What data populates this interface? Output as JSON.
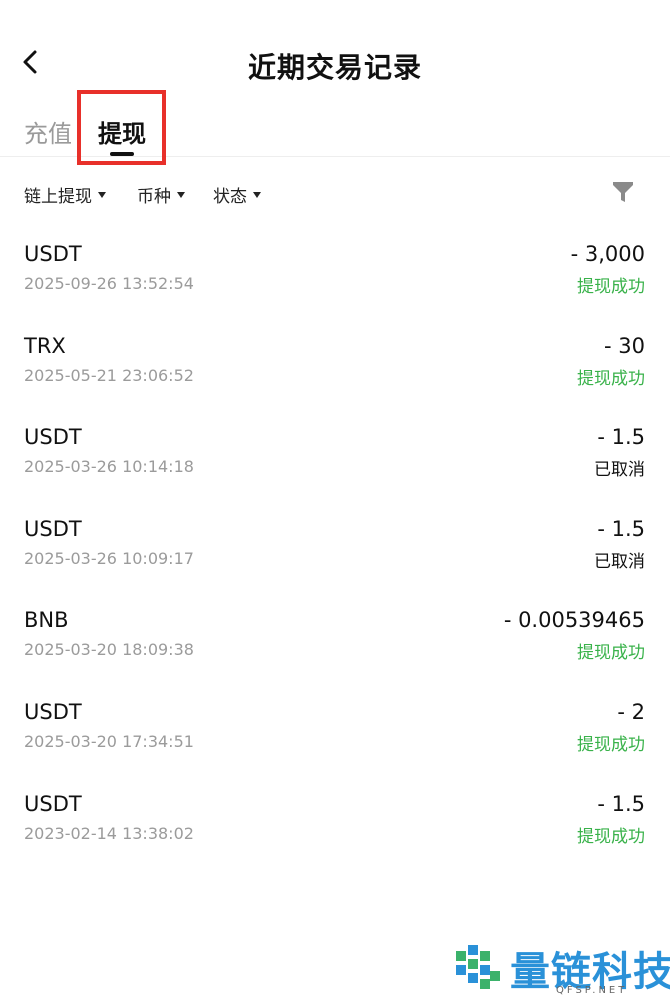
{
  "header": {
    "title": "近期交易记录",
    "back_icon": "chevron-left-icon"
  },
  "tabs": [
    {
      "label": "充值",
      "active": false
    },
    {
      "label": "提现",
      "active": true
    }
  ],
  "filters": {
    "type_label": "链上提现",
    "coin_label": "币种",
    "status_label": "状态",
    "filter_icon": "funnel-icon"
  },
  "transactions": [
    {
      "coin": "USDT",
      "time": "2025-09-26 13:52:54",
      "amount": "- 3,000",
      "status": "提现成功",
      "status_type": "success"
    },
    {
      "coin": "TRX",
      "time": "2025-05-21 23:06:52",
      "amount": "- 30",
      "status": "提现成功",
      "status_type": "success"
    },
    {
      "coin": "USDT",
      "time": "2025-03-26 10:14:18",
      "amount": "- 1.5",
      "status": "已取消",
      "status_type": "cancelled"
    },
    {
      "coin": "USDT",
      "time": "2025-03-26 10:09:17",
      "amount": "- 1.5",
      "status": "已取消",
      "status_type": "cancelled"
    },
    {
      "coin": "BNB",
      "time": "2025-03-20 18:09:38",
      "amount": "- 0.00539465",
      "status": "提现成功",
      "status_type": "success"
    },
    {
      "coin": "USDT",
      "time": "2025-03-20 17:34:51",
      "amount": "- 2",
      "status": "提现成功",
      "status_type": "success"
    },
    {
      "coin": "USDT",
      "time": "2023-02-14 13:38:02",
      "amount": "- 1.5",
      "status": "提现成功",
      "status_type": "success"
    }
  ],
  "colors": {
    "success": "#39b24a",
    "highlight": "#e8302a",
    "watermark": "#2a91d8"
  },
  "watermark": {
    "text": "量链科技",
    "subtext": "QFSP.NET"
  }
}
